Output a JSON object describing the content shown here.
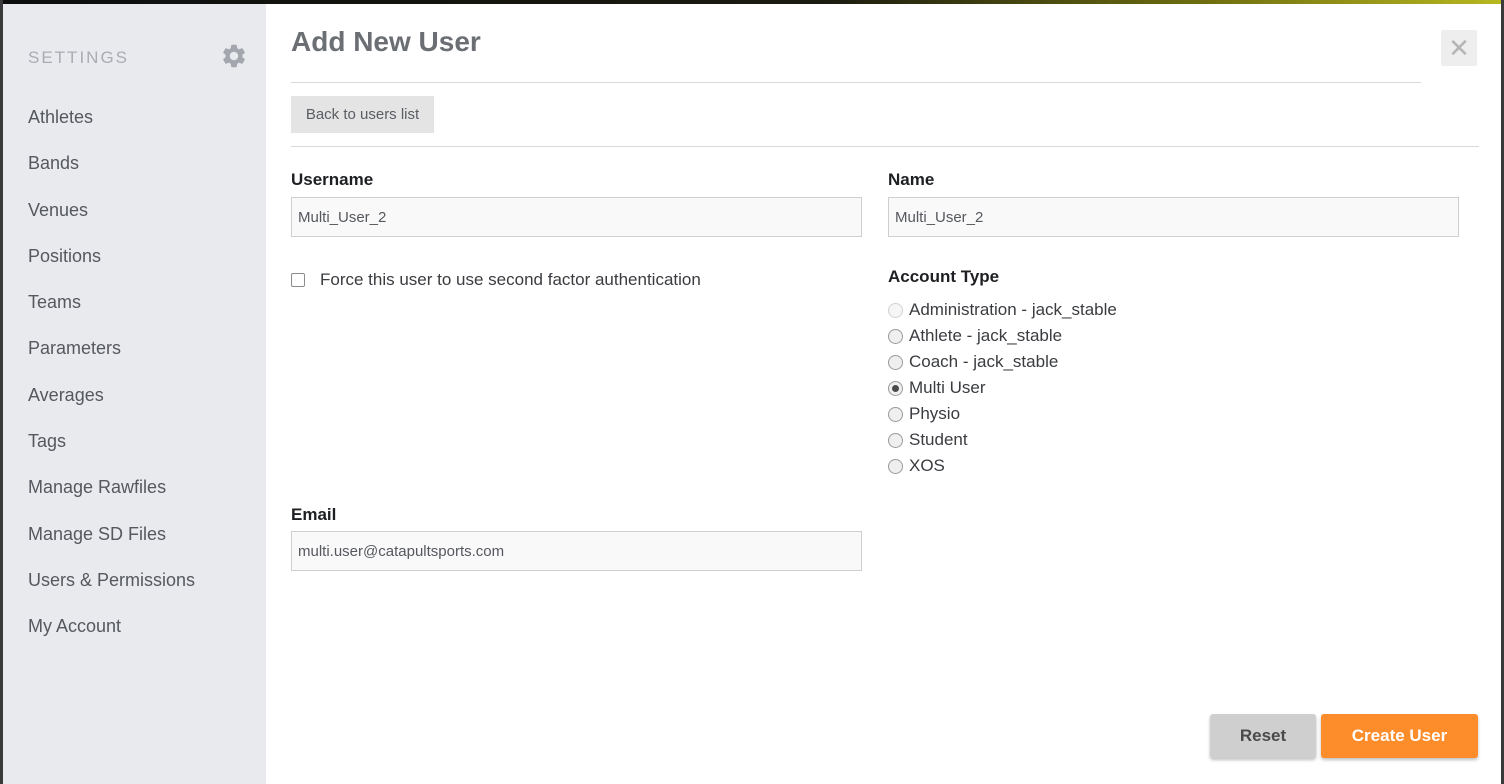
{
  "sidebar": {
    "title": "SETTINGS",
    "gear_icon": "gear-icon",
    "items": [
      {
        "label": "Athletes"
      },
      {
        "label": "Bands"
      },
      {
        "label": "Venues"
      },
      {
        "label": "Positions"
      },
      {
        "label": "Teams"
      },
      {
        "label": "Parameters"
      },
      {
        "label": "Averages"
      },
      {
        "label": "Tags"
      },
      {
        "label": "Manage Rawfiles"
      },
      {
        "label": "Manage SD Files"
      },
      {
        "label": "Users & Permissions"
      },
      {
        "label": "My Account"
      }
    ]
  },
  "main": {
    "title": "Add New User",
    "close_icon": "close-icon",
    "close_glyph": "✕",
    "back_label": "Back to users list"
  },
  "form": {
    "username": {
      "label": "Username",
      "value": "Multi_User_2"
    },
    "name": {
      "label": "Name",
      "value": "Multi_User_2"
    },
    "two_factor": {
      "label": "Force this user to use second factor authentication",
      "checked": false
    },
    "account_type": {
      "label": "Account Type",
      "selected": "Multi User",
      "options": [
        {
          "label": "Administration - jack_stable",
          "disabled": true
        },
        {
          "label": "Athlete - jack_stable",
          "disabled": false
        },
        {
          "label": "Coach - jack_stable",
          "disabled": false
        },
        {
          "label": "Multi User",
          "disabled": false
        },
        {
          "label": "Physio",
          "disabled": false
        },
        {
          "label": "Student",
          "disabled": false
        },
        {
          "label": "XOS",
          "disabled": false
        }
      ]
    },
    "email": {
      "label": "Email",
      "value": "multi.user@catapultsports.com"
    }
  },
  "actions": {
    "reset_label": "Reset",
    "create_label": "Create User"
  },
  "colors": {
    "accent": "#fd8c2b",
    "sidebar_bg": "#e9eaee"
  }
}
